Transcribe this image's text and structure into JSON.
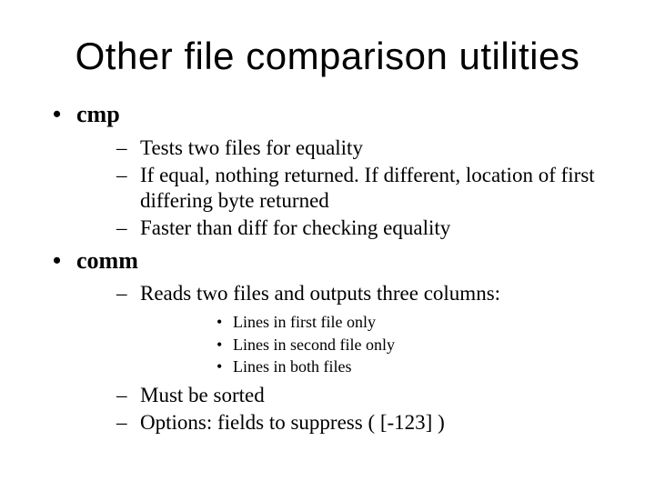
{
  "title": "Other file comparison utilities",
  "items": [
    {
      "label": "cmp",
      "sub": [
        "Tests two files for equality",
        "If equal, nothing returned.  If different, location of first differing byte returned",
        "Faster than diff for checking equality"
      ]
    },
    {
      "label": "comm",
      "sub": [
        {
          "text": "Reads two files and outputs three columns:",
          "sub": [
            "Lines in first file only",
            "Lines in second file only",
            "Lines in both files"
          ]
        },
        "Must be sorted",
        "Options: fields to suppress ( [-123] )"
      ]
    }
  ]
}
